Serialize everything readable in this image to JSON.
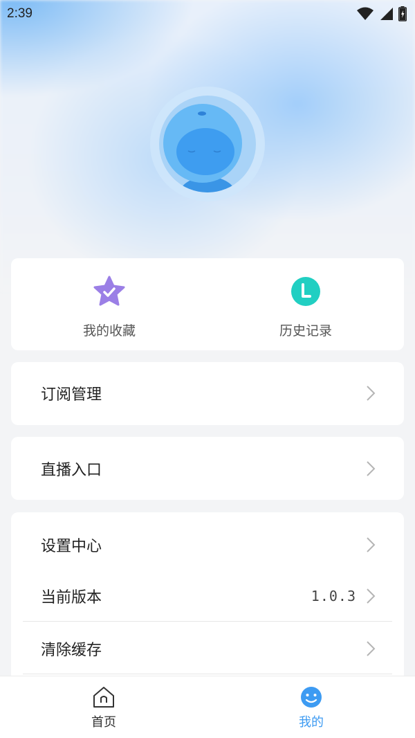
{
  "status_bar": {
    "time": "2:39",
    "icons": [
      "wifi-icon",
      "signal-icon",
      "battery-icon"
    ]
  },
  "profile": {
    "avatar_icon": "avatar-icon"
  },
  "quick_actions": [
    {
      "label": "我的收藏",
      "icon": "star-check-icon",
      "color": "#9b7fe6"
    },
    {
      "label": "历史记录",
      "icon": "clock-icon",
      "color": "#21cfc2"
    }
  ],
  "menu": {
    "subscription": {
      "label": "订阅管理"
    },
    "live": {
      "label": "直播入口"
    },
    "settings": {
      "label": "设置中心"
    },
    "version": {
      "label": "当前版本",
      "value": "1.0.3"
    },
    "clear_cache": {
      "label": "清除缓存"
    }
  },
  "tabbar": {
    "tabs": [
      {
        "label": "首页",
        "icon": "home-icon",
        "active": false
      },
      {
        "label": "我的",
        "icon": "smiley-icon",
        "active": true
      }
    ],
    "active_color": "#3d9bf2",
    "inactive_color": "#333333"
  }
}
